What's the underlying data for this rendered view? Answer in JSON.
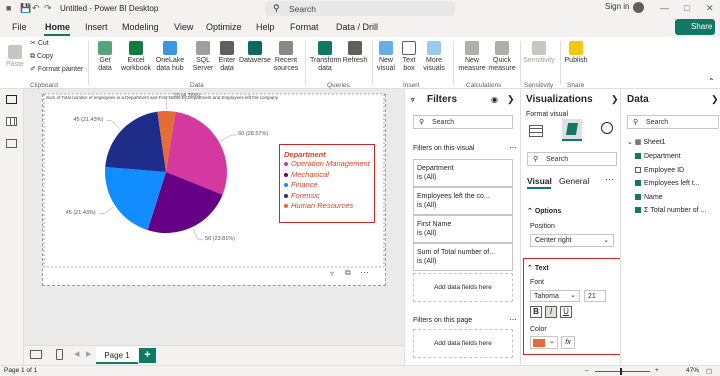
{
  "app": {
    "title": "Untitled - Power BI Desktop",
    "search_label": "Search"
  },
  "menu": {
    "items": [
      "File",
      "Home",
      "Insert",
      "Modeling",
      "View",
      "Optimize",
      "Help",
      "Format",
      "Data / Drill"
    ],
    "share": "Share"
  },
  "ribbon": {
    "clipboard": {
      "paste": "Paste",
      "cut": "Cut",
      "copy": "Copy",
      "painter": "Format painter",
      "group": "Clipboard"
    },
    "data_buttons": [
      "Get data",
      "Excel workbook",
      "OneLake data hub",
      "SQL Server",
      "Enter data",
      "Dataverse",
      "Recent sources"
    ],
    "data_group": "Data",
    "queries_buttons": [
      "Transform data",
      "Refresh"
    ],
    "queries_group": "Queries",
    "insert_buttons": [
      "New visual",
      "Text box",
      "More visuals"
    ],
    "insert_group": "Insert",
    "calc_buttons": [
      "New measure",
      "Quick measure"
    ],
    "calc_group": "Calculations",
    "sensitivity": "Sensitivity",
    "sensitivity_group": "Sensitivity",
    "publish": "Publish",
    "share_group": "Share"
  },
  "visual": {
    "title": "Sum of Total number of employees in a Department and First Name by Department and Employees left the company"
  },
  "chart_data": {
    "type": "pie",
    "legend_title": "Department",
    "slices": [
      {
        "name": "Operation Management",
        "value": 60,
        "pct": "28.57%",
        "label": "60 (28.57%)",
        "color": "#d5389e"
      },
      {
        "name": "Mechanical",
        "value": 50,
        "pct": "23.81%",
        "label": "50 (23.81%)",
        "color": "#650086"
      },
      {
        "name": "Finance",
        "value": 45,
        "pct": "21.43%",
        "label": "45 (21.43%)",
        "color": "#118dff"
      },
      {
        "name": "Forensic",
        "value": 45,
        "pct": "21.43%",
        "label": "45 (21.43%)",
        "color": "#1f2d8a"
      },
      {
        "name": "Human Resources",
        "value": 10,
        "pct": "4.76%",
        "label": "10 (4.76%)",
        "color": "#e66c37"
      }
    ]
  },
  "pages": {
    "tab": "Page 1",
    "add": "+"
  },
  "status": {
    "left": "Page 1 of 1",
    "zoom": "47%"
  },
  "filters": {
    "title": "Filters",
    "search": "Search",
    "on_visual": "Filters on this visual",
    "cards": [
      {
        "name": "Department",
        "value": "is (All)"
      },
      {
        "name": "Employees left the co...",
        "value": "is (All)"
      },
      {
        "name": "First Name",
        "value": "is (All)"
      },
      {
        "name": "Sum of Total number of...",
        "value": "is (All)"
      }
    ],
    "add_fields": "Add data fields here",
    "on_page": "Filters on this page"
  },
  "viz": {
    "title": "Visualizations",
    "format_visual": "Format visual",
    "search": "Search",
    "tab_visual": "Visual",
    "tab_general": "General",
    "options": "Options",
    "position_label": "Position",
    "position_value": "Center right",
    "text": "Text",
    "font_label": "Font",
    "font_value": "Tahoma",
    "font_size": "21",
    "color_label": "Color",
    "fx": "fx",
    "color_value": "#e66c37"
  },
  "data": {
    "title": "Data",
    "search": "Search",
    "table": "Sheet1",
    "fields": [
      {
        "name": "Department",
        "checked": true
      },
      {
        "name": "Employee ID",
        "checked": false
      },
      {
        "name": "Employees left t...",
        "checked": true
      },
      {
        "name": "Name",
        "checked": true
      },
      {
        "name": "Total number of ...",
        "checked": true
      }
    ]
  }
}
